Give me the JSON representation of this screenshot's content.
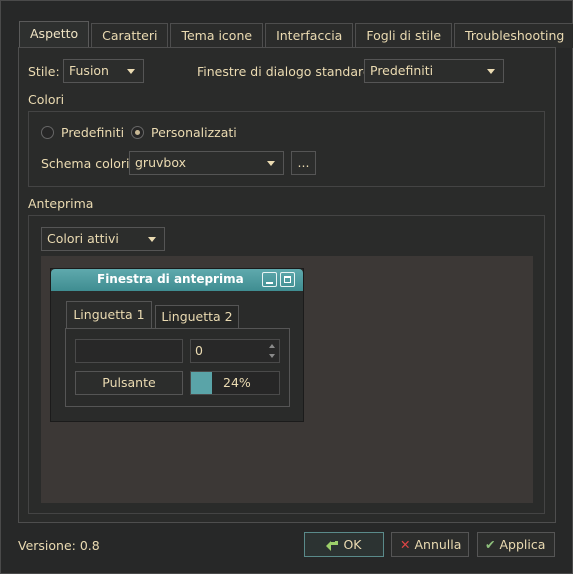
{
  "tabs": [
    "Aspetto",
    "Caratteri",
    "Tema icone",
    "Interfaccia",
    "Fogli di stile",
    "Troubleshooting"
  ],
  "style": {
    "label": "Stile:",
    "value": "Fusion"
  },
  "dialogs": {
    "label": "Finestre di dialogo standard:",
    "value": "Predefiniti"
  },
  "colors": {
    "section_title": "Colori",
    "radio_default": "Predefiniti",
    "radio_custom": "Personalizzati",
    "selected": "Personalizzati",
    "scheme_label": "Schema colori:",
    "scheme_value": "gruvbox",
    "more_button": "..."
  },
  "preview": {
    "section_title": "Anteprima",
    "group_value": "Colori attivi",
    "window_title": "Finestra di anteprima",
    "tab1": "Linguetta 1",
    "tab2": "Linguetta 2",
    "spin_value": "0",
    "button_label": "Pulsante",
    "progress_text": "24%",
    "progress_value": 0.24
  },
  "footer": {
    "version": "Versione: 0.8",
    "ok": "OK",
    "cancel": "Annulla",
    "apply": "Applica"
  },
  "accent_color": "#5aa4a8"
}
